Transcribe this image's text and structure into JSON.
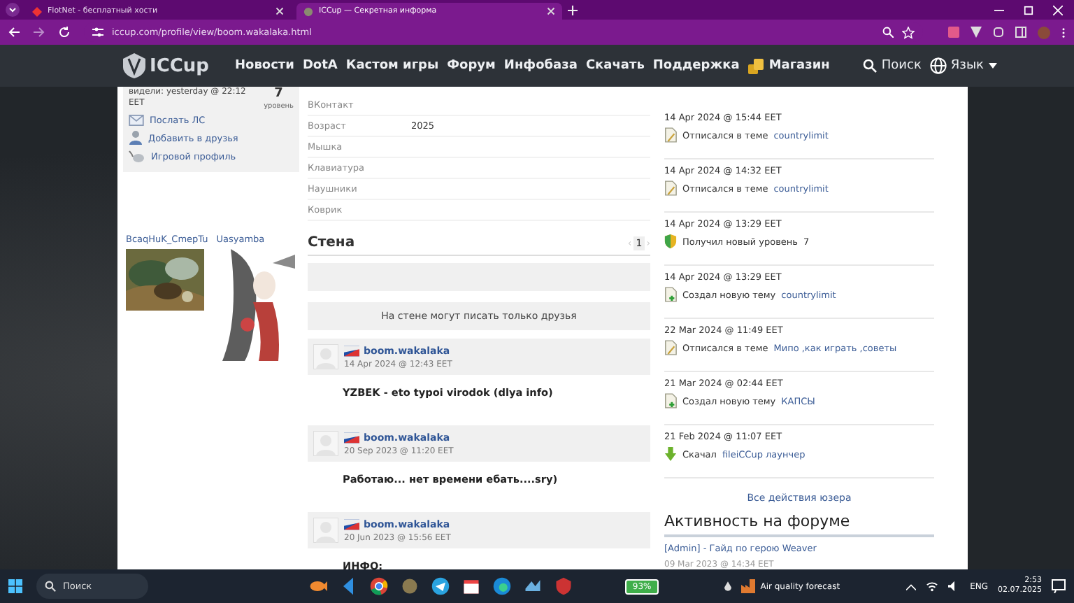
{
  "browser": {
    "tabs": [
      {
        "title": "FlotNet - бесплатный хости",
        "selected": false
      },
      {
        "title": "ICCup — Секретная информа",
        "selected": true
      }
    ],
    "address": "iccup.com/profile/view/boom.wakalaka.html"
  },
  "site_nav": {
    "logo": "ICCup",
    "items": [
      {
        "label": "Новости",
        "kind": "link"
      },
      {
        "label": "DotA",
        "kind": "link"
      },
      {
        "label": "Кастом игры",
        "kind": "link"
      },
      {
        "label": "Форум",
        "kind": "link"
      },
      {
        "label": "Инфобаза",
        "kind": "link"
      },
      {
        "label": "Скачать",
        "kind": "link"
      },
      {
        "label": "Поддержка",
        "kind": "link"
      },
      {
        "label": "Магазин",
        "kind": "shop"
      }
    ],
    "search": "Поиск",
    "language": "Язык"
  },
  "profile_card": {
    "seen": "видели: yesterday @ 22:12",
    "seen_zone": "EET",
    "level": "7",
    "level_label": "уровень",
    "actions": [
      {
        "label": "Послать ЛС",
        "kind": "mail"
      },
      {
        "label": "Добавить в друзья",
        "kind": "friend"
      },
      {
        "label": "Игровой профиль",
        "kind": "game"
      }
    ]
  },
  "friends": [
    {
      "name": "BcaqHuK_CmepTu"
    },
    {
      "name": "Uasyamba"
    }
  ],
  "profile_fields": [
    {
      "label": "ВКонтакт"
    },
    {
      "label": "Возраст",
      "value": "2025"
    },
    {
      "label": "Мышка"
    },
    {
      "label": "Клавиатура"
    },
    {
      "label": "Наушники"
    },
    {
      "label": "Коврик"
    }
  ],
  "wall": {
    "title": "Стена",
    "prev": "‹",
    "page": "1",
    "next": "›",
    "notice": "На стене могут писать только друзья",
    "posts": [
      {
        "author": "boom.wakalaka",
        "date": "14 Apr 2024 @ 12:43 EET",
        "text": "YZBEK - eto typoi virodok (dlya info)"
      },
      {
        "author": "boom.wakalaka",
        "date": "20 Sep 2023 @ 11:20 EET",
        "text": "Работаю... нет времени ебать....sry)"
      },
      {
        "author": "boom.wakalaka",
        "date": "20 Jun 2023 @ 15:56 EET",
        "text": "ИНФО:"
      }
    ]
  },
  "activity": {
    "items": [
      {
        "date": "14 Apr 2024 @ 15:44 EET",
        "kind": "reply",
        "action": "Отписался в теме",
        "link": "countrylimit"
      },
      {
        "date": "14 Apr 2024 @ 14:32 EET",
        "kind": "reply",
        "action": "Отписался в теме",
        "link": "countrylimit"
      },
      {
        "date": "14 Apr 2024 @ 13:29 EET",
        "kind": "level",
        "action": "Получил новый уровень",
        "link": "7"
      },
      {
        "date": "14 Apr 2024 @ 13:29 EET",
        "kind": "topic",
        "action": "Создал новую тему",
        "link": "countrylimit"
      },
      {
        "date": "22 Mar 2024 @ 11:49 EET",
        "kind": "reply",
        "action": "Отписался в теме",
        "link": "Мипо ,как играть ,советы"
      },
      {
        "date": "21 Mar 2024 @ 02:44 EET",
        "kind": "topic",
        "action": "Создал новую тему",
        "link": "КАПСЫ"
      },
      {
        "date": "21 Feb 2024 @ 11:07 EET",
        "kind": "download",
        "action": "Скачал",
        "link": "fileiCCup лаунчер"
      }
    ],
    "all_link": "Все действия юзера"
  },
  "forum": {
    "title": "Активность на форуме",
    "items": [
      {
        "title": "[Admin] - Гайд по герою Weaver",
        "date": "09 Mar 2023 @ 14:34 EET"
      }
    ]
  },
  "taskbar": {
    "search": "Поиск",
    "battery": "93%",
    "weather": "Air quality forecast",
    "language": "ENG",
    "time": "2:53",
    "date": "02.07.2025"
  }
}
